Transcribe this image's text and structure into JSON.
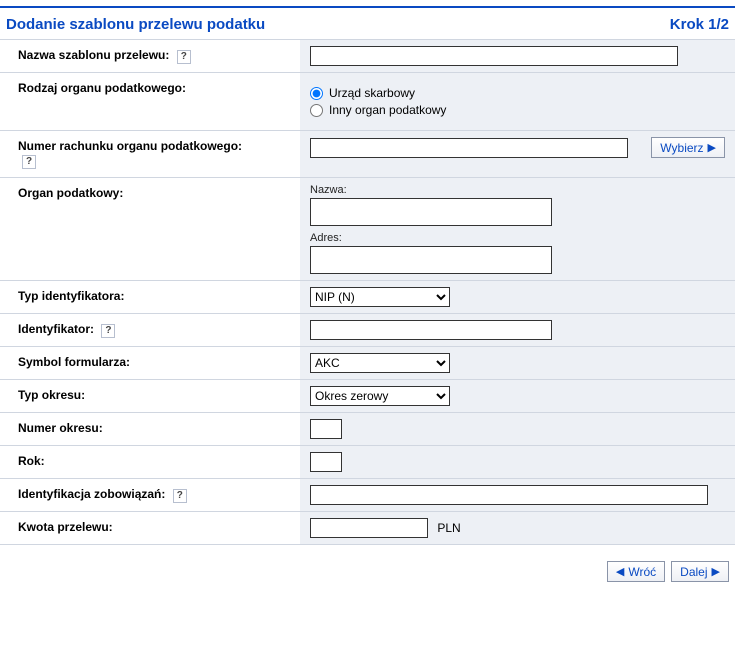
{
  "header": {
    "title": "Dodanie szablonu przelewu podatku",
    "step": "Krok 1/2"
  },
  "labels": {
    "templateName": "Nazwa szablonu przelewu:",
    "authorityType": "Rodzaj organu podatkowego:",
    "accountNumber": "Numer rachunku organu podatkowego:",
    "authority": "Organ podatkowy:",
    "idType": "Typ identyfikatora:",
    "identifier": "Identyfikator:",
    "formSymbol": "Symbol formularza:",
    "periodType": "Typ okresu:",
    "periodNumber": "Numer okresu:",
    "year": "Rok:",
    "obligationId": "Identyfikacja zobowiązań:",
    "amount": "Kwota przelewu:",
    "nameSub": "Nazwa:",
    "addressSub": "Adres:"
  },
  "options": {
    "authorityType": [
      {
        "key": "urzad",
        "label": "Urząd skarbowy",
        "checked": true
      },
      {
        "key": "inny",
        "label": "Inny organ podatkowy",
        "checked": false
      }
    ],
    "idType": "NIP (N)",
    "formSymbol": "AKC",
    "periodType": "Okres zerowy"
  },
  "values": {
    "templateName": "",
    "accountNumber": "",
    "authorityName": "",
    "authorityAddress": "",
    "identifier": "",
    "periodNumber": "",
    "year": "",
    "obligationId": "",
    "amount": ""
  },
  "buttons": {
    "select": "Wybierz",
    "back": "Wróć",
    "next": "Dalej"
  },
  "misc": {
    "currency": "PLN",
    "helpChar": "?"
  }
}
